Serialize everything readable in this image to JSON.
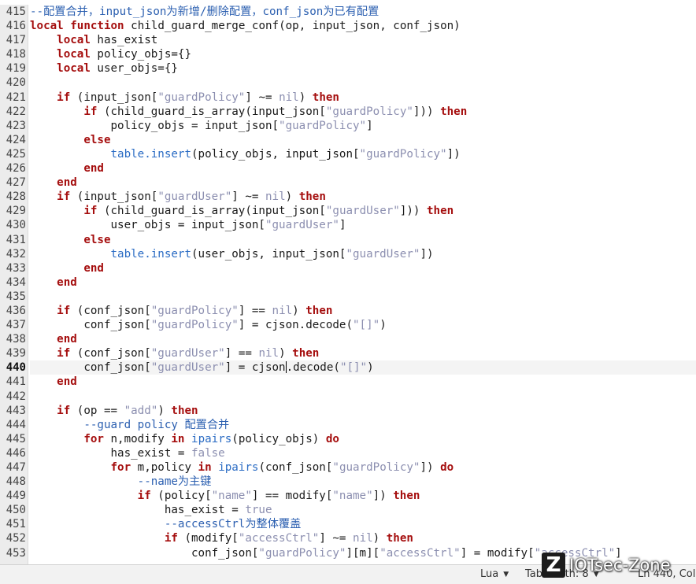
{
  "editor": {
    "current_line": 440,
    "lines": [
      {
        "n": 415,
        "tokens": [
          {
            "t": "com",
            "s": "--配置合并，input_json为新增/删除配置，conf_json为已有配置"
          }
        ]
      },
      {
        "n": 416,
        "tokens": [
          {
            "t": "kw",
            "s": "local"
          },
          {
            "t": "txt",
            "s": " "
          },
          {
            "t": "kw",
            "s": "function"
          },
          {
            "t": "txt",
            "s": " child_guard_merge_conf(op, input_json, conf_json)"
          }
        ]
      },
      {
        "n": 417,
        "tokens": [
          {
            "t": "txt",
            "s": "    "
          },
          {
            "t": "kw",
            "s": "local"
          },
          {
            "t": "txt",
            "s": " has_exist"
          }
        ]
      },
      {
        "n": 418,
        "tokens": [
          {
            "t": "txt",
            "s": "    "
          },
          {
            "t": "kw",
            "s": "local"
          },
          {
            "t": "txt",
            "s": " policy_objs={}"
          }
        ]
      },
      {
        "n": 419,
        "tokens": [
          {
            "t": "txt",
            "s": "    "
          },
          {
            "t": "kw",
            "s": "local"
          },
          {
            "t": "txt",
            "s": " user_objs={}"
          }
        ]
      },
      {
        "n": 420,
        "tokens": []
      },
      {
        "n": 421,
        "tokens": [
          {
            "t": "txt",
            "s": "    "
          },
          {
            "t": "kw",
            "s": "if"
          },
          {
            "t": "txt",
            "s": " (input_json["
          },
          {
            "t": "str",
            "s": "\"guardPolicy\""
          },
          {
            "t": "txt",
            "s": "] ~= "
          },
          {
            "t": "lit",
            "s": "nil"
          },
          {
            "t": "txt",
            "s": ") "
          },
          {
            "t": "kw",
            "s": "then"
          }
        ]
      },
      {
        "n": 422,
        "tokens": [
          {
            "t": "txt",
            "s": "        "
          },
          {
            "t": "kw",
            "s": "if"
          },
          {
            "t": "txt",
            "s": " (child_guard_is_array(input_json["
          },
          {
            "t": "str",
            "s": "\"guardPolicy\""
          },
          {
            "t": "txt",
            "s": "])) "
          },
          {
            "t": "kw",
            "s": "then"
          }
        ]
      },
      {
        "n": 423,
        "tokens": [
          {
            "t": "txt",
            "s": "            policy_objs = input_json["
          },
          {
            "t": "str",
            "s": "\"guardPolicy\""
          },
          {
            "t": "txt",
            "s": "]"
          }
        ]
      },
      {
        "n": 424,
        "tokens": [
          {
            "t": "txt",
            "s": "        "
          },
          {
            "t": "kw",
            "s": "else"
          }
        ]
      },
      {
        "n": 425,
        "tokens": [
          {
            "t": "txt",
            "s": "            "
          },
          {
            "t": "bi",
            "s": "table.insert"
          },
          {
            "t": "txt",
            "s": "(policy_objs, input_json["
          },
          {
            "t": "str",
            "s": "\"guardPolicy\""
          },
          {
            "t": "txt",
            "s": "])"
          }
        ]
      },
      {
        "n": 426,
        "tokens": [
          {
            "t": "txt",
            "s": "        "
          },
          {
            "t": "kw",
            "s": "end"
          }
        ]
      },
      {
        "n": 427,
        "tokens": [
          {
            "t": "txt",
            "s": "    "
          },
          {
            "t": "kw",
            "s": "end"
          }
        ]
      },
      {
        "n": 428,
        "tokens": [
          {
            "t": "txt",
            "s": "    "
          },
          {
            "t": "kw",
            "s": "if"
          },
          {
            "t": "txt",
            "s": " (input_json["
          },
          {
            "t": "str",
            "s": "\"guardUser\""
          },
          {
            "t": "txt",
            "s": "] ~= "
          },
          {
            "t": "lit",
            "s": "nil"
          },
          {
            "t": "txt",
            "s": ") "
          },
          {
            "t": "kw",
            "s": "then"
          }
        ]
      },
      {
        "n": 429,
        "tokens": [
          {
            "t": "txt",
            "s": "        "
          },
          {
            "t": "kw",
            "s": "if"
          },
          {
            "t": "txt",
            "s": " (child_guard_is_array(input_json["
          },
          {
            "t": "str",
            "s": "\"guardUser\""
          },
          {
            "t": "txt",
            "s": "])) "
          },
          {
            "t": "kw",
            "s": "then"
          }
        ]
      },
      {
        "n": 430,
        "tokens": [
          {
            "t": "txt",
            "s": "            user_objs = input_json["
          },
          {
            "t": "str",
            "s": "\"guardUser\""
          },
          {
            "t": "txt",
            "s": "]"
          }
        ]
      },
      {
        "n": 431,
        "tokens": [
          {
            "t": "txt",
            "s": "        "
          },
          {
            "t": "kw",
            "s": "else"
          }
        ]
      },
      {
        "n": 432,
        "tokens": [
          {
            "t": "txt",
            "s": "            "
          },
          {
            "t": "bi",
            "s": "table.insert"
          },
          {
            "t": "txt",
            "s": "(user_objs, input_json["
          },
          {
            "t": "str",
            "s": "\"guardUser\""
          },
          {
            "t": "txt",
            "s": "])"
          }
        ]
      },
      {
        "n": 433,
        "tokens": [
          {
            "t": "txt",
            "s": "        "
          },
          {
            "t": "kw",
            "s": "end"
          }
        ]
      },
      {
        "n": 434,
        "tokens": [
          {
            "t": "txt",
            "s": "    "
          },
          {
            "t": "kw",
            "s": "end"
          }
        ]
      },
      {
        "n": 435,
        "tokens": []
      },
      {
        "n": 436,
        "tokens": [
          {
            "t": "txt",
            "s": "    "
          },
          {
            "t": "kw",
            "s": "if"
          },
          {
            "t": "txt",
            "s": " (conf_json["
          },
          {
            "t": "str",
            "s": "\"guardPolicy\""
          },
          {
            "t": "txt",
            "s": "] == "
          },
          {
            "t": "lit",
            "s": "nil"
          },
          {
            "t": "txt",
            "s": ") "
          },
          {
            "t": "kw",
            "s": "then"
          }
        ]
      },
      {
        "n": 437,
        "tokens": [
          {
            "t": "txt",
            "s": "        conf_json["
          },
          {
            "t": "str",
            "s": "\"guardPolicy\""
          },
          {
            "t": "txt",
            "s": "] = cjson.decode("
          },
          {
            "t": "str",
            "s": "\"[]\""
          },
          {
            "t": "txt",
            "s": ")"
          }
        ]
      },
      {
        "n": 438,
        "tokens": [
          {
            "t": "txt",
            "s": "    "
          },
          {
            "t": "kw",
            "s": "end"
          }
        ]
      },
      {
        "n": 439,
        "tokens": [
          {
            "t": "txt",
            "s": "    "
          },
          {
            "t": "kw",
            "s": "if"
          },
          {
            "t": "txt",
            "s": " (conf_json["
          },
          {
            "t": "str",
            "s": "\"guardUser\""
          },
          {
            "t": "txt",
            "s": "] == "
          },
          {
            "t": "lit",
            "s": "nil"
          },
          {
            "t": "txt",
            "s": ") "
          },
          {
            "t": "kw",
            "s": "then"
          }
        ]
      },
      {
        "n": 440,
        "tokens": [
          {
            "t": "txt",
            "s": "        conf_json["
          },
          {
            "t": "str",
            "s": "\"guardUser\""
          },
          {
            "t": "txt",
            "s": "] = cjson"
          },
          {
            "t": "caret",
            "s": ""
          },
          {
            "t": "txt",
            "s": ".decode("
          },
          {
            "t": "str",
            "s": "\"[]\""
          },
          {
            "t": "txt",
            "s": ")"
          }
        ]
      },
      {
        "n": 441,
        "tokens": [
          {
            "t": "txt",
            "s": "    "
          },
          {
            "t": "kw",
            "s": "end"
          }
        ]
      },
      {
        "n": 442,
        "tokens": []
      },
      {
        "n": 443,
        "tokens": [
          {
            "t": "txt",
            "s": "    "
          },
          {
            "t": "kw",
            "s": "if"
          },
          {
            "t": "txt",
            "s": " (op == "
          },
          {
            "t": "str",
            "s": "\"add\""
          },
          {
            "t": "txt",
            "s": ") "
          },
          {
            "t": "kw",
            "s": "then"
          }
        ]
      },
      {
        "n": 444,
        "tokens": [
          {
            "t": "txt",
            "s": "        "
          },
          {
            "t": "com",
            "s": "--guard policy 配置合并"
          }
        ]
      },
      {
        "n": 445,
        "tokens": [
          {
            "t": "txt",
            "s": "        "
          },
          {
            "t": "kw",
            "s": "for"
          },
          {
            "t": "txt",
            "s": " n,modify "
          },
          {
            "t": "kw",
            "s": "in"
          },
          {
            "t": "txt",
            "s": " "
          },
          {
            "t": "bi",
            "s": "ipairs"
          },
          {
            "t": "txt",
            "s": "(policy_objs) "
          },
          {
            "t": "kw",
            "s": "do"
          }
        ]
      },
      {
        "n": 446,
        "tokens": [
          {
            "t": "txt",
            "s": "            has_exist = "
          },
          {
            "t": "lit",
            "s": "false"
          }
        ]
      },
      {
        "n": 447,
        "tokens": [
          {
            "t": "txt",
            "s": "            "
          },
          {
            "t": "kw",
            "s": "for"
          },
          {
            "t": "txt",
            "s": " m,policy "
          },
          {
            "t": "kw",
            "s": "in"
          },
          {
            "t": "txt",
            "s": " "
          },
          {
            "t": "bi",
            "s": "ipairs"
          },
          {
            "t": "txt",
            "s": "(conf_json["
          },
          {
            "t": "str",
            "s": "\"guardPolicy\""
          },
          {
            "t": "txt",
            "s": "]) "
          },
          {
            "t": "kw",
            "s": "do"
          }
        ]
      },
      {
        "n": 448,
        "tokens": [
          {
            "t": "txt",
            "s": "                "
          },
          {
            "t": "com",
            "s": "--name为主键"
          }
        ]
      },
      {
        "n": 449,
        "tokens": [
          {
            "t": "txt",
            "s": "                "
          },
          {
            "t": "kw",
            "s": "if"
          },
          {
            "t": "txt",
            "s": " (policy["
          },
          {
            "t": "str",
            "s": "\"name\""
          },
          {
            "t": "txt",
            "s": "] == modify["
          },
          {
            "t": "str",
            "s": "\"name\""
          },
          {
            "t": "txt",
            "s": "]) "
          },
          {
            "t": "kw",
            "s": "then"
          }
        ]
      },
      {
        "n": 450,
        "tokens": [
          {
            "t": "txt",
            "s": "                    has_exist = "
          },
          {
            "t": "lit",
            "s": "true"
          }
        ]
      },
      {
        "n": 451,
        "tokens": [
          {
            "t": "txt",
            "s": "                    "
          },
          {
            "t": "com",
            "s": "--accessCtrl为整体覆盖"
          }
        ]
      },
      {
        "n": 452,
        "tokens": [
          {
            "t": "txt",
            "s": "                    "
          },
          {
            "t": "kw",
            "s": "if"
          },
          {
            "t": "txt",
            "s": " (modify["
          },
          {
            "t": "str",
            "s": "\"accessCtrl\""
          },
          {
            "t": "txt",
            "s": "] ~= "
          },
          {
            "t": "lit",
            "s": "nil"
          },
          {
            "t": "txt",
            "s": ") "
          },
          {
            "t": "kw",
            "s": "then"
          }
        ]
      },
      {
        "n": 453,
        "tokens": [
          {
            "t": "txt",
            "s": "                        conf_json["
          },
          {
            "t": "str",
            "s": "\"guardPolicy\""
          },
          {
            "t": "txt",
            "s": "][m]["
          },
          {
            "t": "str",
            "s": "\"accessCtrl\""
          },
          {
            "t": "txt",
            "s": "] = modify["
          },
          {
            "t": "str",
            "s": "\"accessCtrl\""
          },
          {
            "t": "txt",
            "s": "]"
          }
        ]
      }
    ]
  },
  "statusbar": {
    "language": "Lua",
    "tab_width": "Tab Width: 8",
    "position": "Ln 440, Col"
  },
  "watermark": {
    "logo": "Z",
    "text": "IOTsec-Zone"
  }
}
